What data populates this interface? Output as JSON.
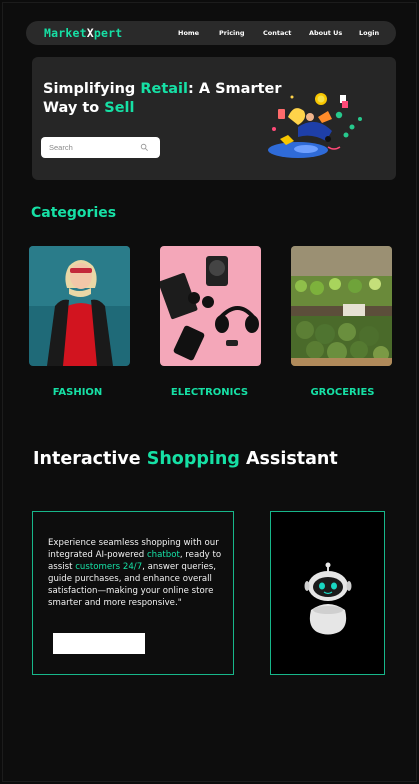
{
  "nav": {
    "logo_part1": "Market",
    "logo_part2": "X",
    "logo_part3": "pert",
    "links": [
      {
        "label": "Home"
      },
      {
        "label": "Pricing"
      },
      {
        "label": "Contact"
      },
      {
        "label": "About Us"
      },
      {
        "label": "Login"
      }
    ]
  },
  "hero": {
    "title_pre": "Simplifying ",
    "title_highlight": "Retail",
    "title_mid": ": A Smarter Way to ",
    "title_highlight2": "Sell",
    "search_placeholder": "Search",
    "search_icon": "search-icon",
    "illustration": "shopping-illustration"
  },
  "categories": {
    "title": "Categories",
    "items": [
      {
        "label": "FASHION",
        "image": "fashion-photo"
      },
      {
        "label": "ELECTRONICS",
        "image": "electronics-photo"
      },
      {
        "label": "GROCERIES",
        "image": "groceries-photo"
      }
    ]
  },
  "assistant": {
    "title_pre": "Interactive ",
    "title_highlight": "Shopping",
    "title_post": " Assistant",
    "text_1": "Experience seamless shopping with our integrated AI-powered ",
    "text_chatbot": "chatbot",
    "text_2": ", ready to assist ",
    "text_customers": "customers 24/7",
    "text_3": ", answer queries, guide purchases, and enhance overall satisfaction—making your online store smarter and more responsive.\"",
    "button_label": "",
    "bot_image": "robot-icon"
  },
  "colors": {
    "accent": "#16e0a5",
    "background": "#0d0d0d",
    "panel": "#262626",
    "nav": "#2a2a2a"
  }
}
